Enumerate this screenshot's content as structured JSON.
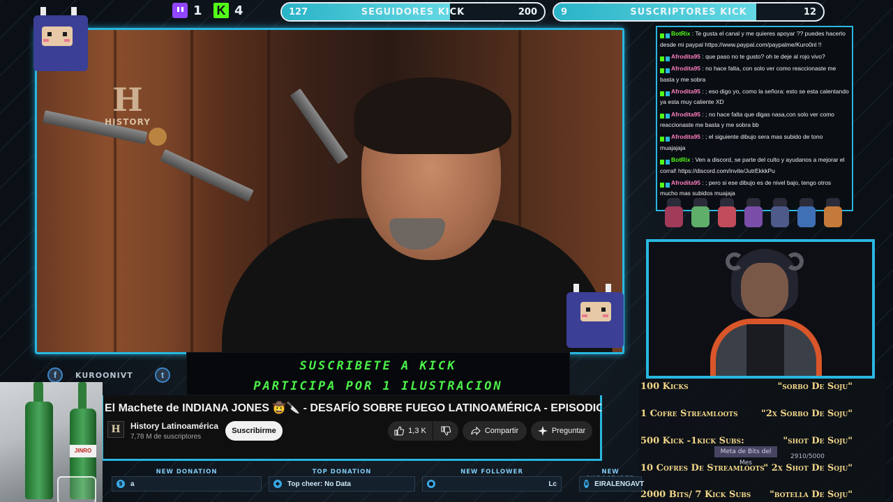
{
  "topbar": {
    "twitch_count": "1",
    "kick_count": "4",
    "followers_goal": {
      "title": "SEGUIDORES KICK",
      "current": "127",
      "target": "200"
    },
    "subs_goal": {
      "title": "SUSCRIPTORES KICK",
      "current": "9",
      "target": "12"
    }
  },
  "video": {
    "history_watermark": "HISTORY"
  },
  "chat": {
    "messages": [
      {
        "user": "BotRix",
        "user_color": "#53fc18",
        "text": "Te gusta el canal y me quieres apoyar ?? puedes hacerlo desde mi paypal https://www.paypal.com/paypalme/Kuro0nl !!"
      },
      {
        "user": "Afrodita95",
        "user_color": "#ff7ec0",
        "text": "que paso no te gusto? oh te deje al rojo vivo?"
      },
      {
        "user": "Afrodita95",
        "user_color": "#ff7ec0",
        "text": "no hace falta, con solo ver como reaccionaste me basta y me sobra"
      },
      {
        "user": "Afrodita95",
        "user_color": "#ff7ec0",
        "text": "; eso digo yo, como la señora: esto se esta calentando ya esta muy caliente XD"
      },
      {
        "user": "Afrodita95",
        "user_color": "#ff7ec0",
        "text": "; no hace falta que digas nasa,con solo ver como reaccionaste me basta y me sobra bb"
      },
      {
        "user": "Afrodita95",
        "user_color": "#ff7ec0",
        "text": "; el siguiente dibujo sera mas subido de tono muajajaja"
      },
      {
        "user": "BotRix",
        "user_color": "#53fc18",
        "text": "Ven a discord, se parte del culto y ayudanos a mejorar el corral! https://discord.com/invite/JutrEkkkPu"
      },
      {
        "user": "Afrodita95",
        "user_color": "#ff7ec0",
        "text": "; pero si ese dibujo es de nivel bajo, tengo otros mucho mas subidos muajaja"
      }
    ]
  },
  "banner": {
    "line1": "SUSCRIBETE A KICK",
    "line2": "PARTICIPA POR 1 ILUSTRACION"
  },
  "social": {
    "facebook_handle": "KUROONIVT"
  },
  "youtube": {
    "title": "El Machete de INDIANA JONES 🤠🔪 - DESAFÍO SOBRE FUEGO LATINOAMÉRICA - EPISODIO COMPLETO",
    "channel": "History Latinoamérica",
    "subscribers": "7,78 M de suscriptores",
    "subscribe_label": "Suscribirme",
    "likes": "1,3 K",
    "share_label": "Compartir",
    "ask_label": "Preguntar",
    "channel_logo_letter": "H"
  },
  "alerts": {
    "new_donation": {
      "label": "NEW DONATION",
      "value": "a"
    },
    "top_donation": {
      "label": "TOP DONATION",
      "value": "Top cheer: No Data"
    },
    "new_follower": {
      "label": "NEW FOLLOWER",
      "value": "Lc"
    },
    "new_subscriber": {
      "label": "NEW SUBSCRIBER",
      "value": "EIRALENGAVT"
    }
  },
  "tips": [
    {
      "left": "100 Kicks",
      "right": "\"sorbo De Soju\""
    },
    {
      "left": "1 Cofre Streamloots",
      "right": "\"2x Sorbo De Soju\""
    },
    {
      "left": "500 Kick -1kick Subs:",
      "right": "\"shot De Soju\""
    },
    {
      "left": "10 Cofres De Streamloots",
      "right": "\" 2x Shot De Soju\""
    },
    {
      "left": "2000 Bits/ 7 Kick Subs",
      "right": "\"botella De Soju\""
    }
  ],
  "bits_goal": {
    "label": "Meta de Bits del Mes",
    "progress": "2910/5000"
  },
  "webcam": {
    "bottle_label": "JINRO"
  },
  "colors": {
    "accent": "#29b7e0",
    "kick_green": "#53fc18",
    "banner_green": "#4cf04a",
    "tip_gold": "#f4d78a"
  }
}
